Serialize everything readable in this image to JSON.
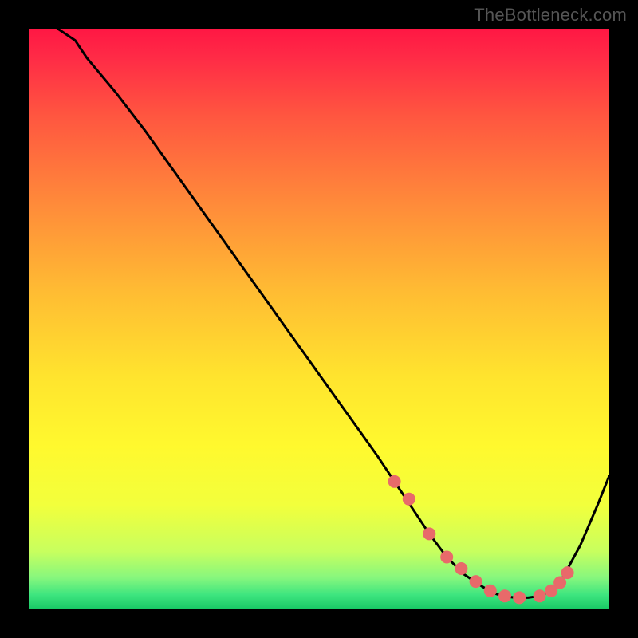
{
  "watermark": "TheBottleneck.com",
  "colors": {
    "frame": "#000000",
    "line": "#000000",
    "marker": "#e86a6a",
    "gradient_stops": [
      {
        "offset": 0.0,
        "color": "#ff1744"
      },
      {
        "offset": 0.05,
        "color": "#ff2b46"
      },
      {
        "offset": 0.15,
        "color": "#ff5640"
      },
      {
        "offset": 0.3,
        "color": "#ff8a3a"
      },
      {
        "offset": 0.45,
        "color": "#ffbb33"
      },
      {
        "offset": 0.6,
        "color": "#ffe42e"
      },
      {
        "offset": 0.72,
        "color": "#fff92e"
      },
      {
        "offset": 0.82,
        "color": "#f2ff3c"
      },
      {
        "offset": 0.9,
        "color": "#c8ff5e"
      },
      {
        "offset": 0.945,
        "color": "#88f77d"
      },
      {
        "offset": 0.975,
        "color": "#3ee57f"
      },
      {
        "offset": 1.0,
        "color": "#18c965"
      }
    ]
  },
  "chart_data": {
    "type": "line",
    "title": "",
    "xlabel": "",
    "ylabel": "",
    "xlim": [
      0,
      100
    ],
    "ylim": [
      0,
      100
    ],
    "grid": false,
    "series": [
      {
        "name": "curve",
        "x": [
          5,
          8,
          10,
          15,
          20,
          25,
          30,
          35,
          40,
          45,
          50,
          55,
          60,
          63,
          66,
          69,
          72,
          75,
          78,
          80,
          82,
          84,
          86,
          88,
          90,
          92,
          95,
          98,
          100
        ],
        "y": [
          100,
          98,
          95,
          89,
          82.5,
          75.5,
          68.5,
          61.5,
          54.5,
          47.5,
          40.5,
          33.5,
          26.5,
          22,
          17.5,
          13,
          9,
          6,
          4,
          2.8,
          2.2,
          2.0,
          2.0,
          2.3,
          3.2,
          5.5,
          11,
          18,
          23
        ]
      }
    ],
    "markers": {
      "name": "highlight-dots",
      "x": [
        63,
        65.5,
        69,
        72,
        74.5,
        77,
        79.5,
        82,
        84.5,
        88,
        90,
        91.5,
        92.8
      ],
      "y": [
        22,
        19,
        13,
        9,
        7,
        4.8,
        3.2,
        2.3,
        2.0,
        2.3,
        3.2,
        4.6,
        6.3
      ]
    }
  }
}
